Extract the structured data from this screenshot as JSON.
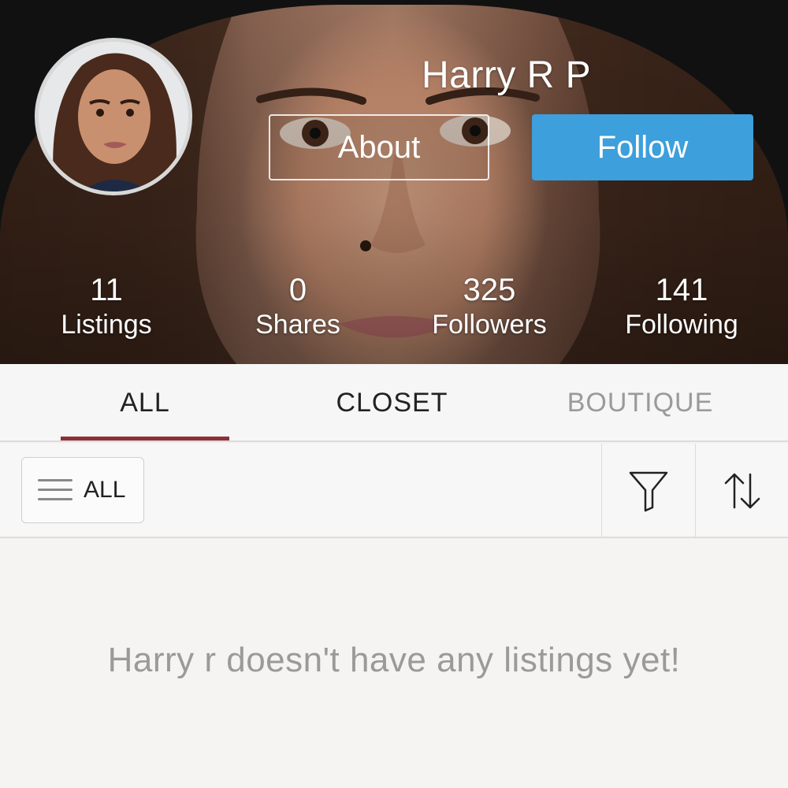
{
  "profile": {
    "name": "Harry R P",
    "about_label": "About",
    "follow_label": "Follow"
  },
  "stats": [
    {
      "value": "11",
      "label": "Listings"
    },
    {
      "value": "0",
      "label": "Shares"
    },
    {
      "value": "325",
      "label": "Followers"
    },
    {
      "value": "141",
      "label": "Following"
    }
  ],
  "tabs": [
    {
      "label": "ALL",
      "active": true
    },
    {
      "label": "CLOSET",
      "active": false
    },
    {
      "label": "BOUTIQUE",
      "active": false
    }
  ],
  "filter_bar": {
    "category_label": "ALL",
    "filter_icon": "filter-funnel-icon",
    "sort_icon": "sort-arrows-icon"
  },
  "empty_state": {
    "message": "Harry r doesn't have any listings yet!"
  },
  "colors": {
    "follow_button": "#3d9fdb",
    "tab_indicator": "#8d2e3a",
    "tab_active_text": "#222222",
    "tab_inactive_text": "#9a9a9a",
    "empty_text": "#9a9a9a"
  }
}
